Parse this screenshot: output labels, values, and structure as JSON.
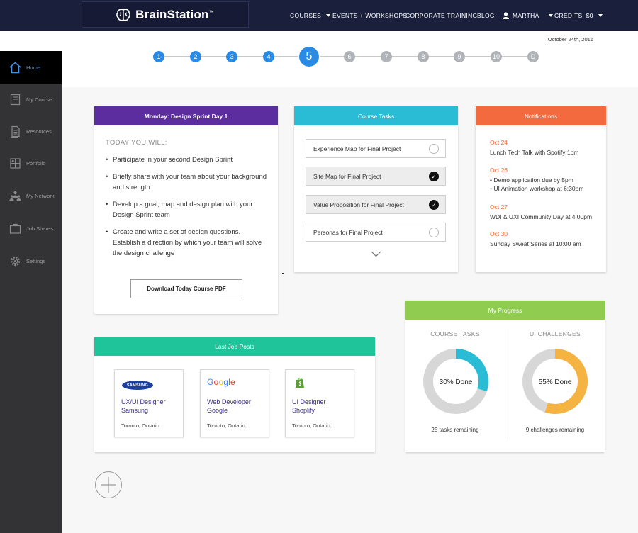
{
  "brand": {
    "name": "BrainStation",
    "tm": "™"
  },
  "topnav": {
    "courses": "COURSES",
    "events": "EVENTS + WORKSHOPS",
    "corporate": "CORPORATE TRAINING",
    "blog": "BLOG",
    "user": "MARTHA",
    "credits": "CREDITS: $0"
  },
  "sidebar": {
    "items": [
      {
        "label": "Home",
        "icon": "home-icon"
      },
      {
        "label": "My Course",
        "icon": "book-icon"
      },
      {
        "label": "Resources",
        "icon": "documents-icon"
      },
      {
        "label": "Portfolio",
        "icon": "portfolio-icon"
      },
      {
        "label": "My Network",
        "icon": "network-icon"
      },
      {
        "label": "Job Shares",
        "icon": "briefcase-icon"
      },
      {
        "label": "Settings",
        "icon": "gear-icon"
      }
    ]
  },
  "date": "October 24th, 2016",
  "steps": [
    "1",
    "2",
    "3",
    "4",
    "5",
    "6",
    "7",
    "8",
    "9",
    "10",
    "D"
  ],
  "current_step": "5",
  "today": {
    "title": "Monday: Design Sprint Day 1",
    "heading": "TODAY YOU WILL:",
    "items": [
      "Participate in your second Design Sprint",
      "Briefly share with your team about your background and strength",
      "Develop a goal, map and design plan with your Design Sprint team",
      "Create and write a set of design questions. Establish a direction by which your team will solve the design challenge"
    ],
    "button": "Download Today Course PDF"
  },
  "tasks": {
    "title": "Course Tasks",
    "items": [
      {
        "label": "Experience Map for Final Project",
        "done": false
      },
      {
        "label": "Site Map for Final Project",
        "done": true
      },
      {
        "label": "Value Proposition for Final Project",
        "done": true
      },
      {
        "label": "Personas for Final Project",
        "done": false
      }
    ]
  },
  "notifications": {
    "title": "Notifications",
    "items": [
      {
        "date": "Oct 24",
        "lines": [
          "Lunch Tech Talk with Spotify 1pm"
        ]
      },
      {
        "date": "Oct 26",
        "lines": [
          "• Demo application due by 5pm",
          "• UI Animation workshop at 6:30pm"
        ]
      },
      {
        "date": "Oct 27",
        "lines": [
          "WDI & UXI Community Day at 4:00pm"
        ]
      },
      {
        "date": "Oct 30",
        "lines": [
          "Sunday Sweat Series at 10:00 am"
        ]
      }
    ]
  },
  "jobs": {
    "title": "Last Job Posts",
    "items": [
      {
        "logo": "SAMSUNG",
        "role": "UX/UI Designer",
        "company": "Samsung",
        "location": "Toronto, Ontario"
      },
      {
        "logo": "Google",
        "role": "Web Developer",
        "company": "Google",
        "location": "Toronto, Ontario"
      },
      {
        "logo": "shopify-icon",
        "role": "UI Designer",
        "company": "Shoplify",
        "location": "Toronto, Ontario"
      }
    ]
  },
  "progress": {
    "title": "My Progress",
    "tasks": {
      "label": "COURSE TASKS",
      "percent": 30,
      "text": "30% Done",
      "remaining": "25 tasks remaining",
      "color": "#29bcd4"
    },
    "challenges": {
      "label": "UI CHALLENGES",
      "percent": 55,
      "text": "55% Done",
      "remaining": "9 challenges remaining",
      "color": "#f5b342"
    }
  },
  "colors": {
    "topbar": "#1a1f3c",
    "today_header": "#5b2d9e",
    "tasks_header": "#29bcd4",
    "notifications_header": "#f26a3d",
    "jobs_header": "#1fc49a",
    "progress_header": "#8fcc4f",
    "accent": "#2a8be4"
  }
}
